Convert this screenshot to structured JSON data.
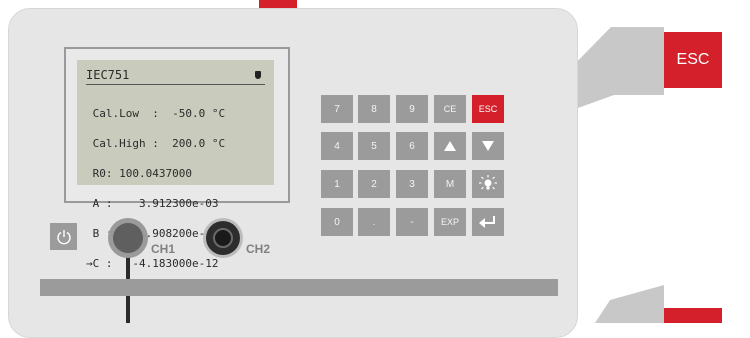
{
  "lcd": {
    "title": "IEC751",
    "lines": [
      " Cal.Low  :  -50.0 °C",
      " Cal.High :  200.0 °C",
      " R0: 100.0437000",
      " A :    3.912300e-03",
      " B :   -5.908200e-07",
      "→C :   -4.183000e-12"
    ]
  },
  "keypad": {
    "row1": [
      "7",
      "8",
      "9",
      "CE",
      "ESC"
    ],
    "row2": [
      "4",
      "5",
      "6",
      "up-arrow-icon",
      "down-arrow-icon"
    ],
    "row3": [
      "1",
      "2",
      "3",
      "M",
      "backlight-icon"
    ],
    "row4": [
      "0",
      ".",
      "-",
      "EXP",
      "enter-icon"
    ]
  },
  "channels": {
    "ch1": "CH1",
    "ch2": "CH2"
  },
  "callout": {
    "label": "ESC"
  },
  "colors": {
    "accent": "#d3202a",
    "panel": "#e6e6e6",
    "key": "#9b9b9b",
    "lcd": "#c9ccbc"
  }
}
